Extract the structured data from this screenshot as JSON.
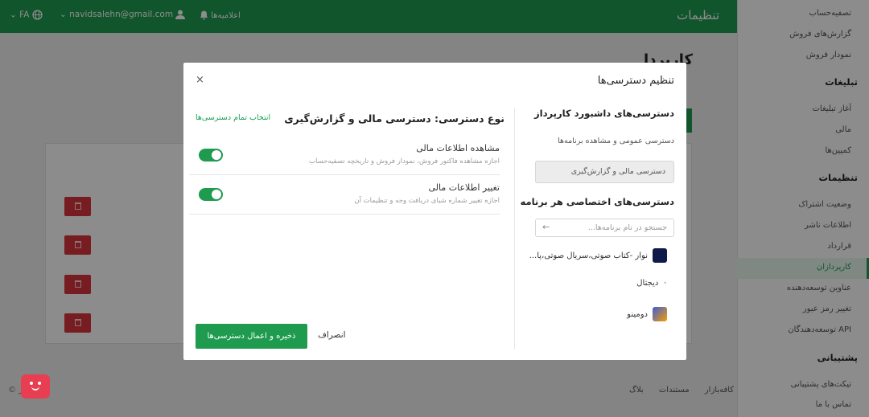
{
  "header": {
    "title": "تنظیمات",
    "notifications": "اعلامیه‌ها",
    "email": "navidsalehn@gmail.com",
    "lang": "FA"
  },
  "sidebar": {
    "items": [
      {
        "label": "تصفیه‌حساب"
      },
      {
        "label": "گزارش‌های فروش"
      },
      {
        "label": "نمودار فروش"
      }
    ],
    "sections": [
      {
        "title": "تبلیغات",
        "items": [
          "آغاز تبلیغات",
          "مالی",
          "کمپین‌ها"
        ]
      },
      {
        "title": "تنظیمات",
        "items": [
          "وضعیت اشتراک",
          "اطلاعات ناشر",
          "قرارداد",
          "کارپردازان",
          "عناوین توسعه‌دهنده",
          "تغییر رمز عبور",
          "API توسعه‌دهندگان"
        ]
      },
      {
        "title": "پشتیبانی",
        "items": [
          "تیکت‌های پشتیبانی",
          "تماس با ما"
        ]
      }
    ],
    "active": "کارپردازان"
  },
  "background": {
    "title": "کارپردا",
    "footer": [
      "کافه‌بازار",
      "مستندات",
      "بلاگ"
    ],
    "copy": "© بازار"
  },
  "modal": {
    "title": "تنظیم دسترسی‌ها",
    "close": "×",
    "left_heading": "دسترسی‌های داشبورد کارپرداز",
    "general_access": "دسترسی عمومی و مشاهده برنامه‌ها",
    "financial_access": "دسترسی مالی و گزارش‌گیری",
    "apps_heading": "دسترسی‌های اختصاصی هر برنامه",
    "search_placeholder": "جستجو در نام برنامه‌ها...",
    "apps": [
      {
        "name": "نوار -کتاب صوتی،سریال صوتی،پا...",
        "color": "#1a2a6c"
      },
      {
        "name": "دیجتال",
        "color": ""
      },
      {
        "name": "دومینو",
        "color": "#3b5bdb"
      }
    ],
    "access_type_heading": "نوع دسترسی: دسترسی مالی و گزارش‌گیری",
    "select_all": "انتخاب تمام دسترسی‌ها",
    "permissions": [
      {
        "title": "مشاهده اطلاعات مالی",
        "desc": "اجازه مشاهده فاکتور فروش، نمودار فروش و تاریخچه تصفیه‌حساب",
        "enabled": true
      },
      {
        "title": "تغییر اطلاعات مالی",
        "desc": "اجازه تغییر شماره شبای دریافت وجه و تنظیمات آن",
        "enabled": true
      }
    ],
    "save_label": "ذخیره و اعمال دسترسی‌ها",
    "cancel_label": "انصراف"
  },
  "colors": {
    "primary": "#1e9b4f",
    "danger": "#d9363e",
    "fab": "#e83e51"
  }
}
